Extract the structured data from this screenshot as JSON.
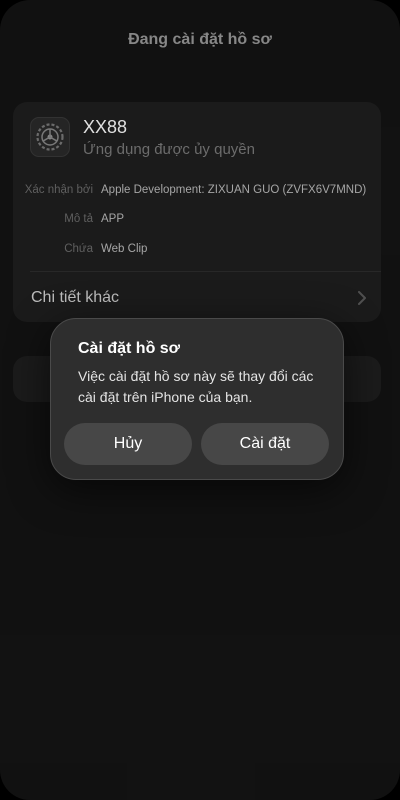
{
  "header": {
    "title": "Đang cài đặt hồ sơ"
  },
  "profile": {
    "name": "XX88",
    "subtitle": "Ứng dụng được ủy quyền",
    "icon": "settings-gear-icon",
    "details": [
      {
        "label": "Xác nhận bởi",
        "value": "Apple Development: ZIXUAN GUO (ZVFX6V7MND)"
      },
      {
        "label": "Mô tả",
        "value": "APP"
      },
      {
        "label": "Chứa",
        "value": "Web Clip"
      }
    ],
    "more_label": "Chi tiết khác"
  },
  "alert": {
    "title": "Cài đặt hồ sơ",
    "message": "Việc cài đặt hồ sơ này sẽ thay đổi các cài đặt trên iPhone của bạn.",
    "cancel_label": "Hủy",
    "install_label": "Cài đặt"
  }
}
